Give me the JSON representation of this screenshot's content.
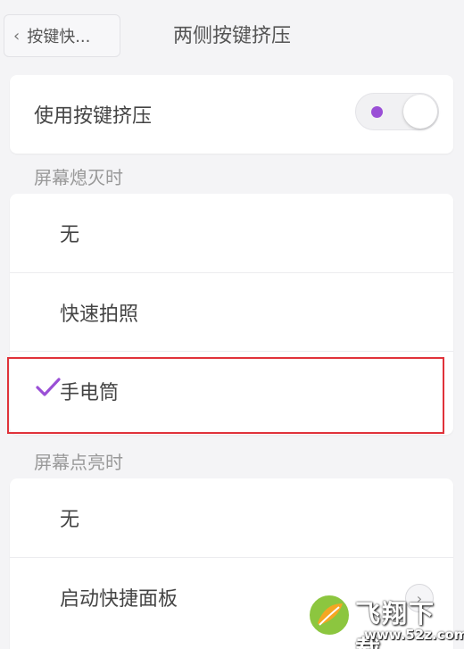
{
  "header": {
    "back_label": "按键快...",
    "title": "两侧按键挤压"
  },
  "toggle_setting": {
    "label": "使用按键挤压",
    "enabled": true,
    "accent_color": "#9a4fd6"
  },
  "screen_off": {
    "section_label": "屏幕熄灭时",
    "options": [
      {
        "label": "无"
      },
      {
        "label": "快速拍照"
      },
      {
        "label": "手电筒",
        "selected": true
      }
    ]
  },
  "screen_on": {
    "section_label": "屏幕点亮时",
    "options": [
      {
        "label": "无"
      },
      {
        "label": "启动快捷面板"
      }
    ]
  },
  "highlight_color": "#e0323a",
  "watermark": {
    "brand": "飞翔下载",
    "url": "www.52z.com"
  }
}
